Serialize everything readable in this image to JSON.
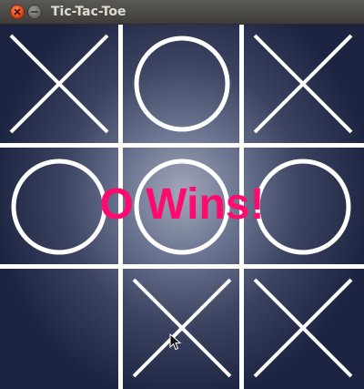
{
  "window": {
    "title": "Tic-Tac-Toe"
  },
  "colors": {
    "mark": "#ffffff",
    "message": "#ff0a6e"
  },
  "board": {
    "cells": [
      "X",
      "O",
      "X",
      "O",
      "O",
      "O",
      "",
      "X",
      "X"
    ]
  },
  "status": {
    "message": "O Wins!"
  }
}
